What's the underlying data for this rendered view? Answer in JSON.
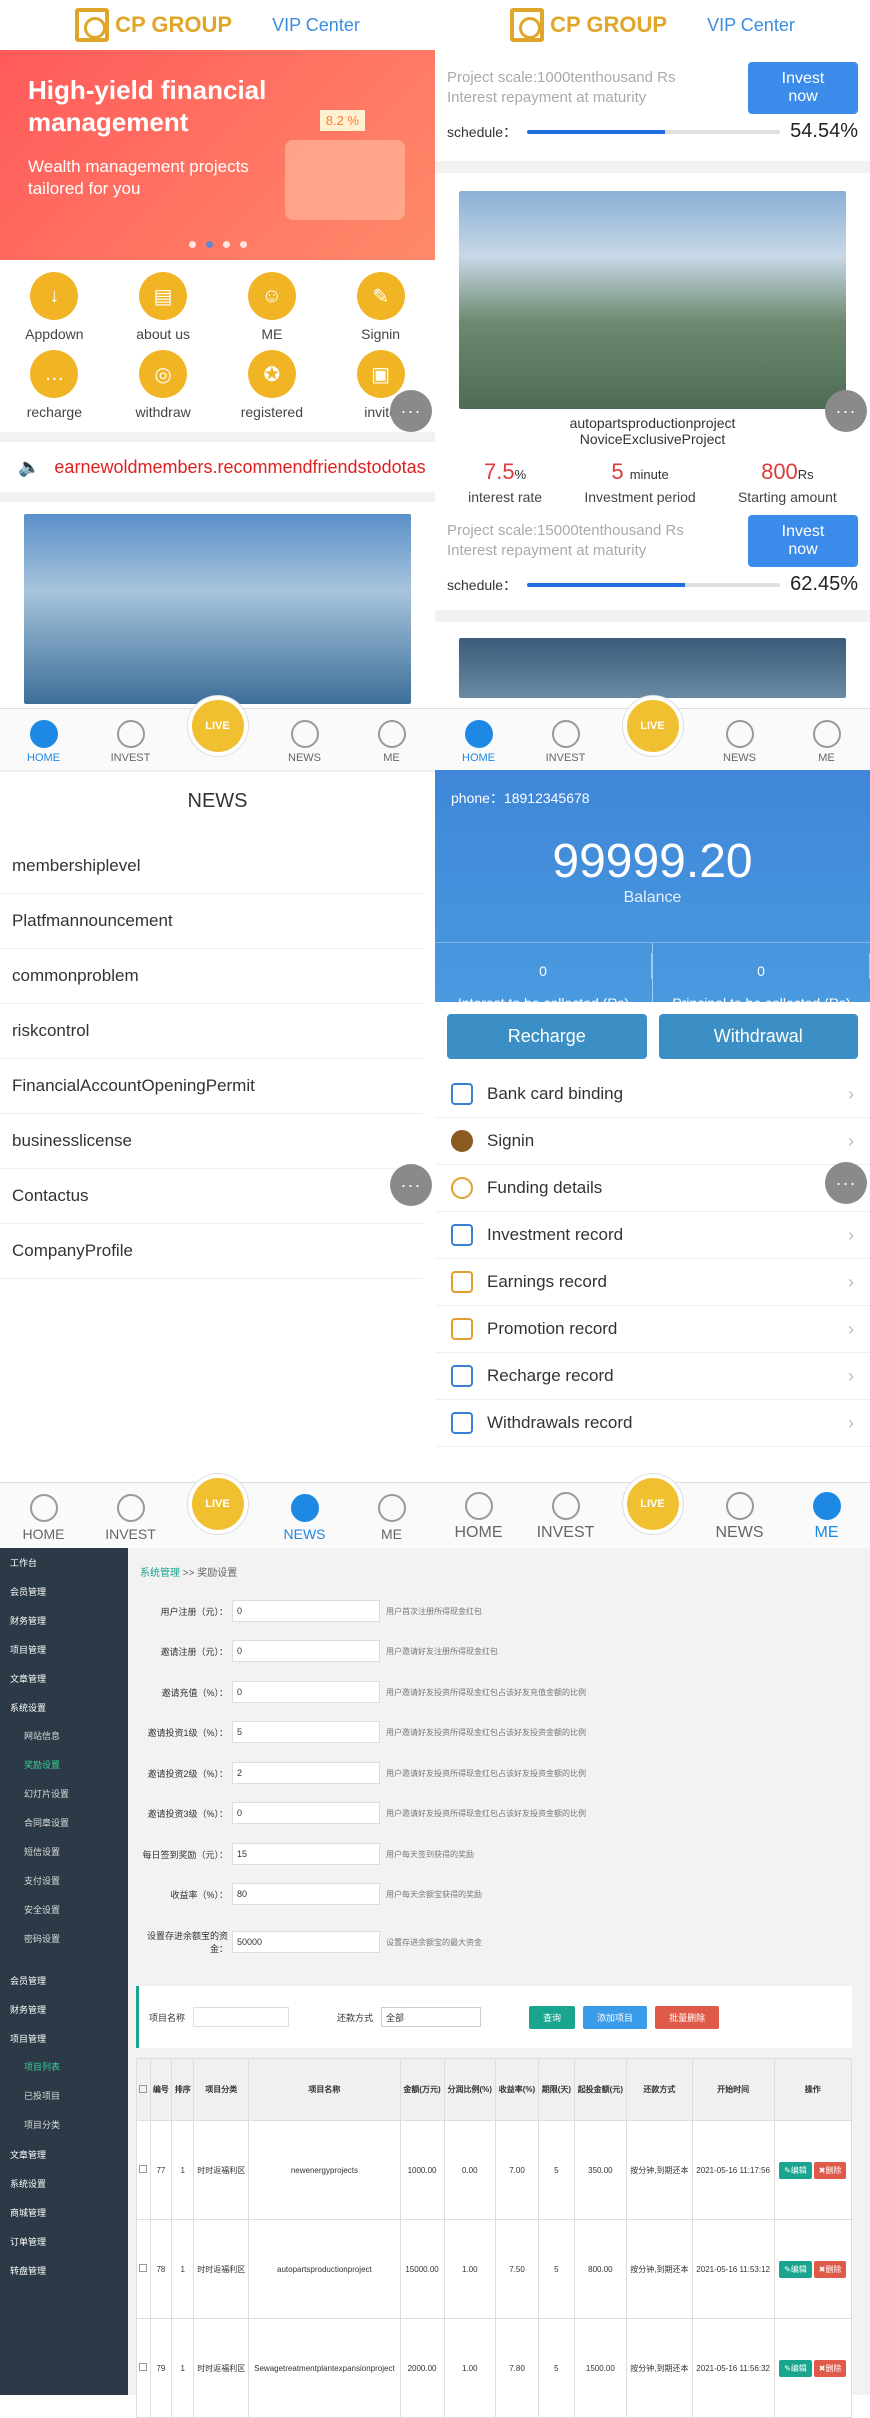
{
  "brand": {
    "logo": "CP GROUP",
    "vip": "VIP Center"
  },
  "tabs": [
    "HOME",
    "INVEST",
    "LIVE",
    "NEWS",
    "ME"
  ],
  "more": "···",
  "home": {
    "banner": {
      "title": "High-yield financial management",
      "sub": "Wealth management projects tailored for you",
      "badge": "8.2 %"
    },
    "grid": [
      "Appdown",
      "about us",
      "ME",
      "Signin",
      "recharge",
      "withdraw",
      "registered",
      "invite"
    ],
    "notice": "earnewoldmembers.recommendfriendstodotas"
  },
  "invest": {
    "top": {
      "scale": "Project scale:1000tenthousand Rs",
      "repay": "Interest repayment at maturity",
      "button": "Invest now",
      "schedule": "schedule：",
      "percent": "54.54%",
      "progress": 0.5454
    },
    "product": {
      "name": "autopartsproductionproject",
      "tag": "NoviceExclusiveProject",
      "rate": "7.5",
      "rate_unit": "%",
      "period": "5",
      "period_unit": "minute",
      "start": "800",
      "start_unit": "Rs",
      "rate_l": "interest rate",
      "period_l": "Investment period",
      "start_l": "Starting amount",
      "scale": "Project scale:15000tenthousand Rs",
      "repay": "Interest repayment at maturity",
      "button": "Invest now",
      "schedule": "schedule：",
      "percent": "62.45%",
      "progress": 0.6245
    }
  },
  "news": {
    "title": "NEWS",
    "items": [
      "membershiplevel",
      "Platfmannouncement",
      "commonproblem",
      "riskcontrol",
      "FinancialAccountOpeningPermit",
      "businesslicense",
      "Contactus",
      "CompanyProfile"
    ]
  },
  "account": {
    "phone": "phone：18912345678",
    "balance": "99999.20",
    "balance_l": "Balance",
    "interest": "0",
    "interest_l": "Interest to be collected (Rs)",
    "principal": "0",
    "principal_l": "Principal to be collected (Rs)",
    "recharge": "Recharge",
    "withdrawal": "Withdrawal",
    "menu": [
      "Bank card binding",
      "Signin",
      "Funding details",
      "Investment record",
      "Earnings record",
      "Promotion record",
      "Recharge record",
      "Withdrawals record"
    ]
  },
  "admin": {
    "side_top": [
      "工作台",
      "会员管理",
      "财务管理",
      "项目管理",
      "文章管理",
      "系统设置"
    ],
    "side_sub": [
      "网站信息",
      "奖励设置",
      "幻灯片设置",
      "合同章设置",
      "短信设置",
      "支付设置",
      "安全设置",
      "密码设置"
    ],
    "side_bottom": [
      "会员管理",
      "财务管理",
      "项目管理"
    ],
    "side_sub2": [
      "项目列表",
      "已投项目",
      "项目分类"
    ],
    "side_bottom2": [
      "文章管理",
      "系统设置",
      "商城管理",
      "订单管理",
      "转盘管理"
    ],
    "crumb": "系统管理",
    "crumb2": "奖励设置",
    "form": [
      {
        "label": "用户注册（元）：",
        "value": "0",
        "hint": "用户首次注册所得现金红包"
      },
      {
        "label": "邀请注册（元）：",
        "value": "0",
        "hint": "用户邀请好友注册所得现金红包"
      },
      {
        "label": "邀请充值（%）：",
        "value": "0",
        "hint": "用户邀请好友投资所得现金红包占该好友充值金额的比例"
      },
      {
        "label": "邀请投资1级（%）：",
        "value": "5",
        "hint": "用户邀请好友投资所得现金红包占该好友投资金额的比例"
      },
      {
        "label": "邀请投资2级（%）：",
        "value": "2",
        "hint": "用户邀请好友投资所得现金红包占该好友投资金额的比例"
      },
      {
        "label": "邀请投资3级（%）：",
        "value": "0",
        "hint": "用户邀请好友投资所得现金红包占该好友投资金额的比例"
      },
      {
        "label": "每日签到奖励（元）：",
        "value": "15",
        "hint": "用户每天签到获得的奖励"
      },
      {
        "label": "收益率（%）：",
        "value": "80",
        "hint": "用户每天余额宝获得的奖励"
      },
      {
        "label": "设置存进余额宝的资金：",
        "value": "50000",
        "hint": "设置存进余额宝的最大资金"
      }
    ],
    "toolbar": {
      "name_l": "项目名称",
      "repay_l": "还款方式",
      "repay_v": "全部",
      "search": "查询",
      "add": "添加项目",
      "del": "批量删除"
    },
    "headers": [
      "",
      "编号",
      "排序",
      "项目分类",
      "项目名称",
      "金额(万元)",
      "分润比例(%)",
      "收益率(%)",
      "期限(天)",
      "起投金额(元)",
      "还款方式",
      "开始时间",
      "操作"
    ],
    "rows": [
      [
        "77",
        "1",
        "时时返福利区",
        "newenergyprojects",
        "1000.00",
        "0.00",
        "7.00",
        "5",
        "350.00",
        "按分钟,到期还本",
        "2021-05-16 11:17:56"
      ],
      [
        "78",
        "1",
        "时时返福利区",
        "autopartsproductionproject",
        "15000.00",
        "1.00",
        "7.50",
        "5",
        "800.00",
        "按分钟,到期还本",
        "2021-05-16 11:53:12"
      ],
      [
        "79",
        "1",
        "时时返福利区",
        "Sewagetreatmentplantexpansionproject",
        "2000.00",
        "1.00",
        "7.80",
        "5",
        "1500.00",
        "按分钟,到期还本",
        "2021-05-16 11:56:32"
      ]
    ],
    "edit": "编辑",
    "delete": "删除"
  }
}
